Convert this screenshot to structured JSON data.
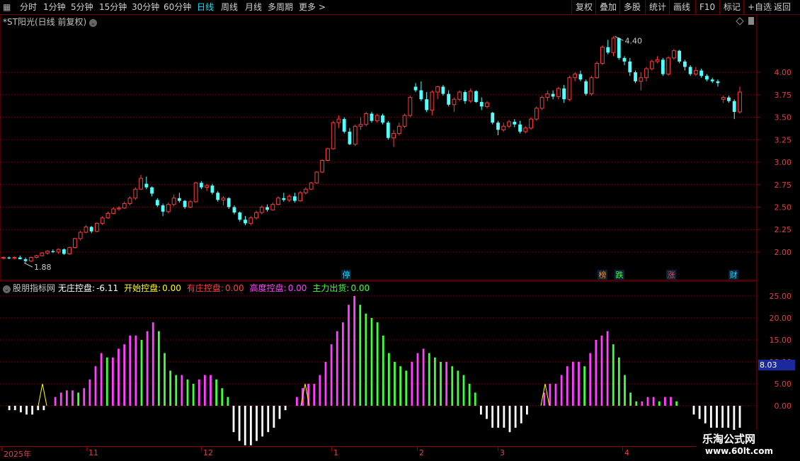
{
  "toolbar": {
    "left": [
      "分时",
      "1分钟",
      "5分钟",
      "15分钟",
      "30分钟",
      "60分钟",
      "日线",
      "周线",
      "月线",
      "多周期",
      "更多 >"
    ],
    "active_index": 6,
    "right": [
      "复权",
      "叠加",
      "多股",
      "统计",
      "画线",
      "F10",
      "标记",
      "+自选",
      "返回"
    ]
  },
  "stock": {
    "title": "*ST阳光(日线 前复权)",
    "high_label": "4.40",
    "low_label": "1.88"
  },
  "price_axis": [
    "4.00",
    "3.75",
    "3.50",
    "3.25",
    "3.00",
    "2.75",
    "2.50",
    "2.25",
    "2.00"
  ],
  "indicator_axis": [
    "25.00",
    "20.00",
    "15.00",
    "10.00",
    "5.00",
    "0.00"
  ],
  "indicator": {
    "name": "股朋指标网",
    "items": [
      {
        "label": "无庄控盘:",
        "value": "-6.11",
        "color": "#ffffff"
      },
      {
        "label": "开始控盘:",
        "value": "0.00",
        "color": "#ffff00"
      },
      {
        "label": "有庄控盘:",
        "value": "0.00",
        "color": "#ff4040"
      },
      {
        "label": "高度控盘:",
        "value": "0.00",
        "color": "#ff40ff"
      },
      {
        "label": "主力出货:",
        "value": "0.00",
        "color": "#40ff40"
      }
    ],
    "current_value": "8.03"
  },
  "x_axis": [
    "2025年",
    "11",
    "12",
    "1",
    "2",
    "3",
    "4"
  ],
  "badges": [
    {
      "text": "停",
      "color": "#00e5ff"
    },
    {
      "text": "榜",
      "color": "#ff8c00"
    },
    {
      "text": "跌",
      "color": "#40ff40"
    },
    {
      "text": "涨",
      "color": "#ff4040"
    },
    {
      "text": "财",
      "color": "#00e5ff"
    }
  ],
  "watermark": {
    "line1": "乐淘公式网",
    "line2": "www.60lt.com"
  },
  "colors": {
    "up": "#ff3c3c",
    "down": "#54ffff",
    "grid": "#8b0000"
  },
  "chart_data": [
    {
      "type": "candlestick",
      "ylim": [
        1.85,
        4.45
      ],
      "ohlc": [
        [
          1.93,
          1.95,
          1.92,
          1.94
        ],
        [
          1.94,
          1.95,
          1.92,
          1.93
        ],
        [
          1.93,
          1.95,
          1.92,
          1.94
        ],
        [
          1.94,
          1.96,
          1.92,
          1.92
        ],
        [
          1.92,
          1.94,
          1.88,
          1.9
        ],
        [
          1.9,
          1.95,
          1.89,
          1.94
        ],
        [
          1.94,
          1.97,
          1.93,
          1.96
        ],
        [
          1.96,
          2.0,
          1.95,
          1.99
        ],
        [
          1.99,
          2.02,
          1.97,
          2.01
        ],
        [
          2.01,
          2.03,
          1.99,
          2.0
        ],
        [
          2.0,
          2.04,
          1.98,
          2.03
        ],
        [
          2.03,
          2.04,
          1.97,
          1.98
        ],
        [
          1.98,
          2.06,
          1.97,
          2.05
        ],
        [
          2.05,
          2.16,
          2.04,
          2.15
        ],
        [
          2.15,
          2.24,
          2.13,
          2.22
        ],
        [
          2.22,
          2.3,
          2.21,
          2.28
        ],
        [
          2.28,
          2.29,
          2.21,
          2.23
        ],
        [
          2.23,
          2.33,
          2.22,
          2.32
        ],
        [
          2.32,
          2.4,
          2.3,
          2.38
        ],
        [
          2.38,
          2.45,
          2.37,
          2.43
        ],
        [
          2.43,
          2.5,
          2.42,
          2.48
        ],
        [
          2.48,
          2.51,
          2.46,
          2.49
        ],
        [
          2.49,
          2.56,
          2.48,
          2.54
        ],
        [
          2.54,
          2.62,
          2.52,
          2.6
        ],
        [
          2.6,
          2.72,
          2.58,
          2.7
        ],
        [
          2.7,
          2.86,
          2.69,
          2.82
        ],
        [
          2.76,
          2.84,
          2.7,
          2.72
        ],
        [
          2.72,
          2.73,
          2.62,
          2.65
        ],
        [
          2.58,
          2.6,
          2.5,
          2.52
        ],
        [
          2.52,
          2.54,
          2.4,
          2.45
        ],
        [
          2.45,
          2.55,
          2.43,
          2.53
        ],
        [
          2.53,
          2.64,
          2.51,
          2.6
        ],
        [
          2.6,
          2.66,
          2.55,
          2.57
        ],
        [
          2.57,
          2.58,
          2.48,
          2.5
        ],
        [
          2.5,
          2.58,
          2.49,
          2.56
        ],
        [
          2.56,
          2.78,
          2.55,
          2.77
        ],
        [
          2.77,
          2.79,
          2.7,
          2.72
        ],
        [
          2.72,
          2.76,
          2.68,
          2.74
        ],
        [
          2.74,
          2.76,
          2.64,
          2.66
        ],
        [
          2.66,
          2.68,
          2.56,
          2.58
        ],
        [
          2.58,
          2.62,
          2.52,
          2.6
        ],
        [
          2.6,
          2.61,
          2.48,
          2.5
        ],
        [
          2.5,
          2.52,
          2.42,
          2.44
        ],
        [
          2.44,
          2.45,
          2.34,
          2.36
        ],
        [
          2.36,
          2.4,
          2.3,
          2.32
        ],
        [
          2.32,
          2.4,
          2.3,
          2.38
        ],
        [
          2.38,
          2.46,
          2.36,
          2.44
        ],
        [
          2.44,
          2.52,
          2.42,
          2.5
        ],
        [
          2.5,
          2.53,
          2.45,
          2.47
        ],
        [
          2.47,
          2.55,
          2.46,
          2.53
        ],
        [
          2.53,
          2.62,
          2.52,
          2.6
        ],
        [
          2.6,
          2.66,
          2.56,
          2.58
        ],
        [
          2.58,
          2.64,
          2.56,
          2.62
        ],
        [
          2.62,
          2.66,
          2.55,
          2.57
        ],
        [
          2.57,
          2.68,
          2.56,
          2.66
        ],
        [
          2.66,
          2.72,
          2.64,
          2.7
        ],
        [
          2.7,
          2.78,
          2.69,
          2.77
        ],
        [
          2.77,
          2.9,
          2.76,
          2.89
        ],
        [
          2.89,
          3.03,
          2.88,
          3.02
        ],
        [
          3.02,
          3.16,
          3.01,
          3.15
        ],
        [
          3.15,
          3.46,
          3.14,
          3.44
        ],
        [
          3.44,
          3.52,
          3.38,
          3.48
        ],
        [
          3.48,
          3.5,
          3.32,
          3.34
        ],
        [
          3.34,
          3.38,
          3.19,
          3.2
        ],
        [
          3.2,
          3.42,
          3.18,
          3.4
        ],
        [
          3.4,
          3.5,
          3.36,
          3.42
        ],
        [
          3.42,
          3.56,
          3.4,
          3.54
        ],
        [
          3.54,
          3.56,
          3.44,
          3.46
        ],
        [
          3.46,
          3.54,
          3.44,
          3.52
        ],
        [
          3.52,
          3.54,
          3.42,
          3.44
        ],
        [
          3.44,
          3.46,
          3.25,
          3.27
        ],
        [
          3.27,
          3.36,
          3.17,
          3.32
        ],
        [
          3.32,
          3.44,
          3.3,
          3.4
        ],
        [
          3.4,
          3.54,
          3.38,
          3.52
        ],
        [
          3.52,
          3.74,
          3.5,
          3.72
        ],
        [
          3.84,
          3.88,
          3.78,
          3.8
        ],
        [
          3.8,
          3.9,
          3.68,
          3.7
        ],
        [
          3.7,
          3.78,
          3.56,
          3.58
        ],
        [
          3.58,
          3.8,
          3.52,
          3.78
        ],
        [
          3.78,
          3.85,
          3.7,
          3.84
        ],
        [
          3.84,
          3.86,
          3.74,
          3.76
        ],
        [
          3.76,
          3.8,
          3.62,
          3.64
        ],
        [
          3.64,
          3.72,
          3.56,
          3.7
        ],
        [
          3.7,
          3.8,
          3.68,
          3.78
        ],
        [
          3.78,
          3.8,
          3.65,
          3.68
        ],
        [
          3.68,
          3.82,
          3.66,
          3.79
        ],
        [
          3.79,
          3.8,
          3.66,
          3.67
        ],
        [
          3.67,
          3.72,
          3.58,
          3.62
        ],
        [
          3.62,
          3.68,
          3.6,
          3.66
        ],
        [
          3.55,
          3.56,
          3.42,
          3.44
        ],
        [
          3.44,
          3.46,
          3.3,
          3.36
        ],
        [
          3.36,
          3.44,
          3.34,
          3.4
        ],
        [
          3.4,
          3.47,
          3.38,
          3.45
        ],
        [
          3.45,
          3.48,
          3.39,
          3.42
        ],
        [
          3.42,
          3.46,
          3.32,
          3.34
        ],
        [
          3.34,
          3.4,
          3.32,
          3.38
        ],
        [
          3.38,
          3.5,
          3.36,
          3.48
        ],
        [
          3.48,
          3.62,
          3.46,
          3.6
        ],
        [
          3.6,
          3.74,
          3.58,
          3.72
        ],
        [
          3.72,
          3.8,
          3.68,
          3.76
        ],
        [
          3.76,
          3.8,
          3.7,
          3.73
        ],
        [
          3.73,
          3.84,
          3.7,
          3.82
        ],
        [
          3.82,
          3.86,
          3.66,
          3.7
        ],
        [
          3.7,
          3.96,
          3.68,
          3.94
        ],
        [
          3.94,
          4.0,
          3.9,
          3.98
        ],
        [
          3.98,
          4.02,
          3.9,
          3.92
        ],
        [
          3.9,
          3.92,
          3.74,
          3.76
        ],
        [
          3.76,
          3.96,
          3.74,
          3.94
        ],
        [
          3.94,
          4.12,
          3.93,
          4.1
        ],
        [
          4.1,
          4.3,
          4.08,
          4.28
        ],
        [
          4.28,
          4.36,
          4.2,
          4.22
        ],
        [
          4.22,
          4.4,
          4.18,
          4.38
        ],
        [
          4.38,
          4.39,
          4.14,
          4.16
        ],
        [
          4.16,
          4.18,
          4.08,
          4.12
        ],
        [
          4.12,
          4.16,
          3.96,
          4.0
        ],
        [
          4.0,
          4.02,
          3.88,
          3.9
        ],
        [
          3.9,
          4.0,
          3.8,
          3.94
        ],
        [
          3.94,
          4.06,
          3.9,
          4.04
        ],
        [
          4.04,
          4.14,
          4.02,
          4.12
        ],
        [
          4.12,
          4.18,
          4.1,
          4.14
        ],
        [
          4.14,
          4.16,
          3.96,
          3.98
        ],
        [
          3.98,
          4.18,
          3.96,
          4.16
        ],
        [
          4.16,
          4.26,
          4.14,
          4.24
        ],
        [
          4.24,
          4.25,
          4.1,
          4.12
        ],
        [
          4.12,
          4.14,
          4.02,
          4.06
        ],
        [
          4.06,
          4.08,
          3.96,
          3.98
        ],
        [
          3.98,
          4.06,
          3.96,
          4.02
        ],
        [
          4.02,
          4.04,
          3.94,
          3.96
        ],
        [
          3.96,
          3.98,
          3.9,
          3.92
        ],
        [
          3.92,
          3.94,
          3.88,
          3.9
        ],
        [
          3.9,
          3.92,
          3.84,
          3.88
        ],
        [
          3.7,
          3.74,
          3.66,
          3.72
        ],
        [
          3.72,
          3.74,
          3.66,
          3.68
        ],
        [
          3.68,
          3.7,
          3.48,
          3.56
        ],
        [
          3.56,
          3.84,
          3.54,
          3.78
        ]
      ]
    },
    {
      "type": "bar",
      "ylim": [
        -9,
        27
      ],
      "series": [
        {
          "name": "无庄控盘",
          "color": "#ffffff",
          "values": [
            -1,
            -1,
            -1,
            -1.5,
            -1.5,
            -2,
            -2,
            -1
          ]
        },
        {
          "name": "开始控盘",
          "color": "#ffff00",
          "values": [
            5,
            5,
            5
          ]
        },
        {
          "name": "高度控盘",
          "color": "#ff40ff",
          "values": []
        },
        {
          "name": "主力出货",
          "color": "#40ff40",
          "values": []
        }
      ],
      "values": [
        0,
        -1,
        -1,
        -1.5,
        -2,
        -2,
        -1,
        -1,
        0,
        2,
        3,
        3.5,
        3.5,
        3,
        4,
        6,
        9,
        12,
        11,
        11,
        13,
        14,
        16,
        16,
        15,
        17,
        19,
        17,
        12,
        8,
        7,
        7,
        6,
        5,
        6,
        7,
        7,
        6,
        4,
        2,
        -6,
        -8,
        -9,
        -9,
        -8,
        -7,
        -6,
        -5,
        -3,
        -1,
        0,
        2,
        4,
        5,
        5,
        7,
        10,
        14,
        17,
        19,
        23,
        25,
        23,
        21,
        20,
        19,
        16,
        12,
        10,
        9,
        8,
        10,
        12,
        13,
        12,
        11,
        10,
        10,
        9,
        8,
        7,
        5,
        3,
        -2,
        -3,
        -5,
        -5,
        -5,
        -6,
        -5,
        -4,
        -2,
        0,
        0,
        3,
        5,
        5,
        7,
        9,
        10,
        10,
        9,
        12,
        15,
        16,
        17,
        14,
        11,
        7,
        3,
        1,
        1,
        2,
        2,
        1,
        2,
        2,
        1,
        0,
        0,
        -2,
        -3,
        -4,
        -5,
        -5,
        -5,
        -5,
        -6,
        -5
      ]
    }
  ]
}
